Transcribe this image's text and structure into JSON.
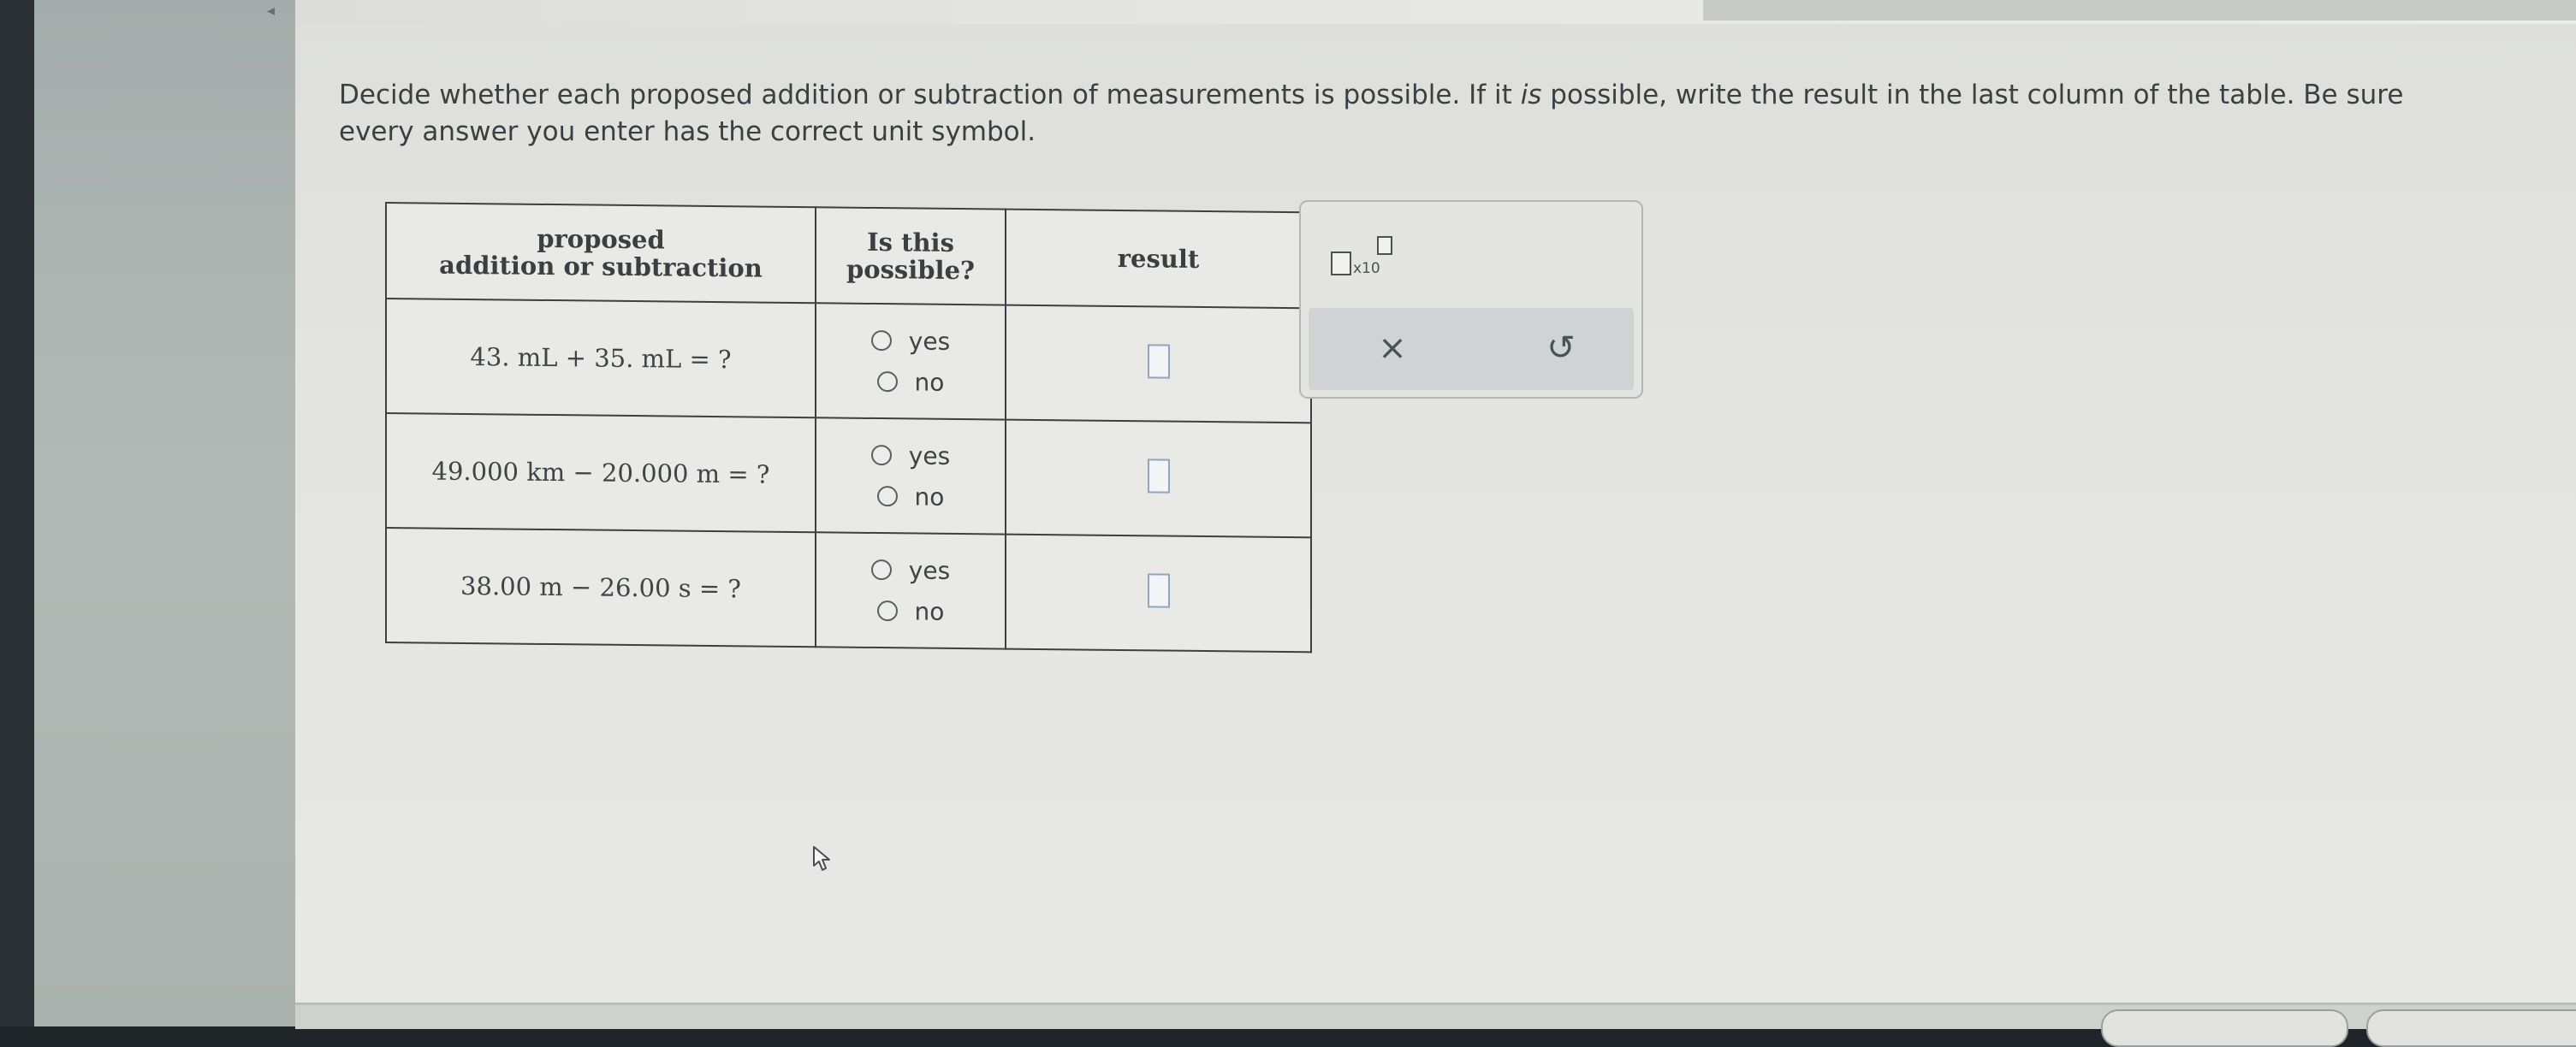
{
  "instructions": {
    "part1": "Decide whether each proposed addition or subtraction of measurements is possible. If it ",
    "emph": "is",
    "part2": " possible, write the result in the last column of the table. Be sure every answer you enter has the correct unit symbol."
  },
  "table": {
    "headers": {
      "col1_line1": "proposed",
      "col1_line2": "addition or subtraction",
      "col2_line1": "Is this",
      "col2_line2": "possible?",
      "col3": "result"
    },
    "rows": [
      {
        "expression": "43. mL + 35. mL = ?",
        "option_yes": "yes",
        "option_no": "no",
        "result": ""
      },
      {
        "expression": "49.000 km − 20.000 m = ?",
        "option_yes": "yes",
        "option_no": "no",
        "result": ""
      },
      {
        "expression": "38.00 m − 26.00 s = ?",
        "option_yes": "yes",
        "option_no": "no",
        "result": ""
      }
    ]
  },
  "tools": {
    "x10_label": "x10",
    "clear_icon": "close-icon",
    "reset_icon": "undo-icon",
    "clear_glyph": "×",
    "reset_glyph": "↺"
  }
}
